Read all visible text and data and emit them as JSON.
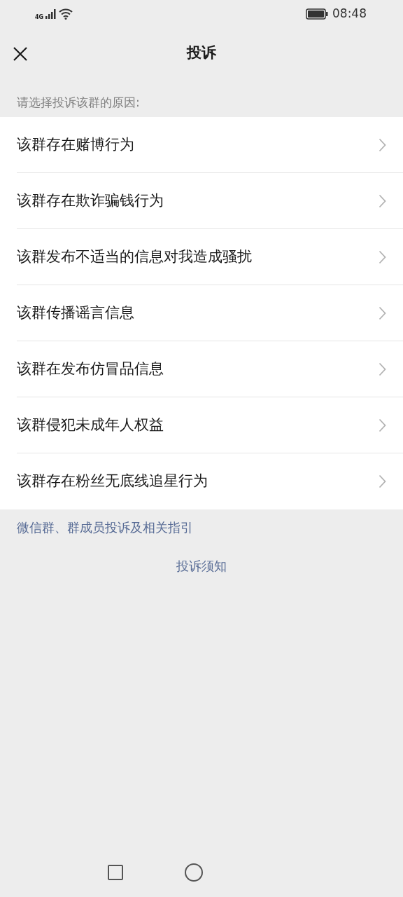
{
  "status_bar": {
    "network": "4G",
    "time": "08:48"
  },
  "header": {
    "title": "投诉"
  },
  "section_label": "请选择投诉该群的原因:",
  "reasons": [
    "该群存在赌博行为",
    "该群存在欺诈骗钱行为",
    "该群发布不适当的信息对我造成骚扰",
    "该群传播谣言信息",
    "该群在发布仿冒品信息",
    "该群侵犯未成年人权益",
    "该群存在粉丝无底线追星行为"
  ],
  "guide_link": "微信群、群成员投诉及相关指引",
  "notice_link": "投诉须知"
}
